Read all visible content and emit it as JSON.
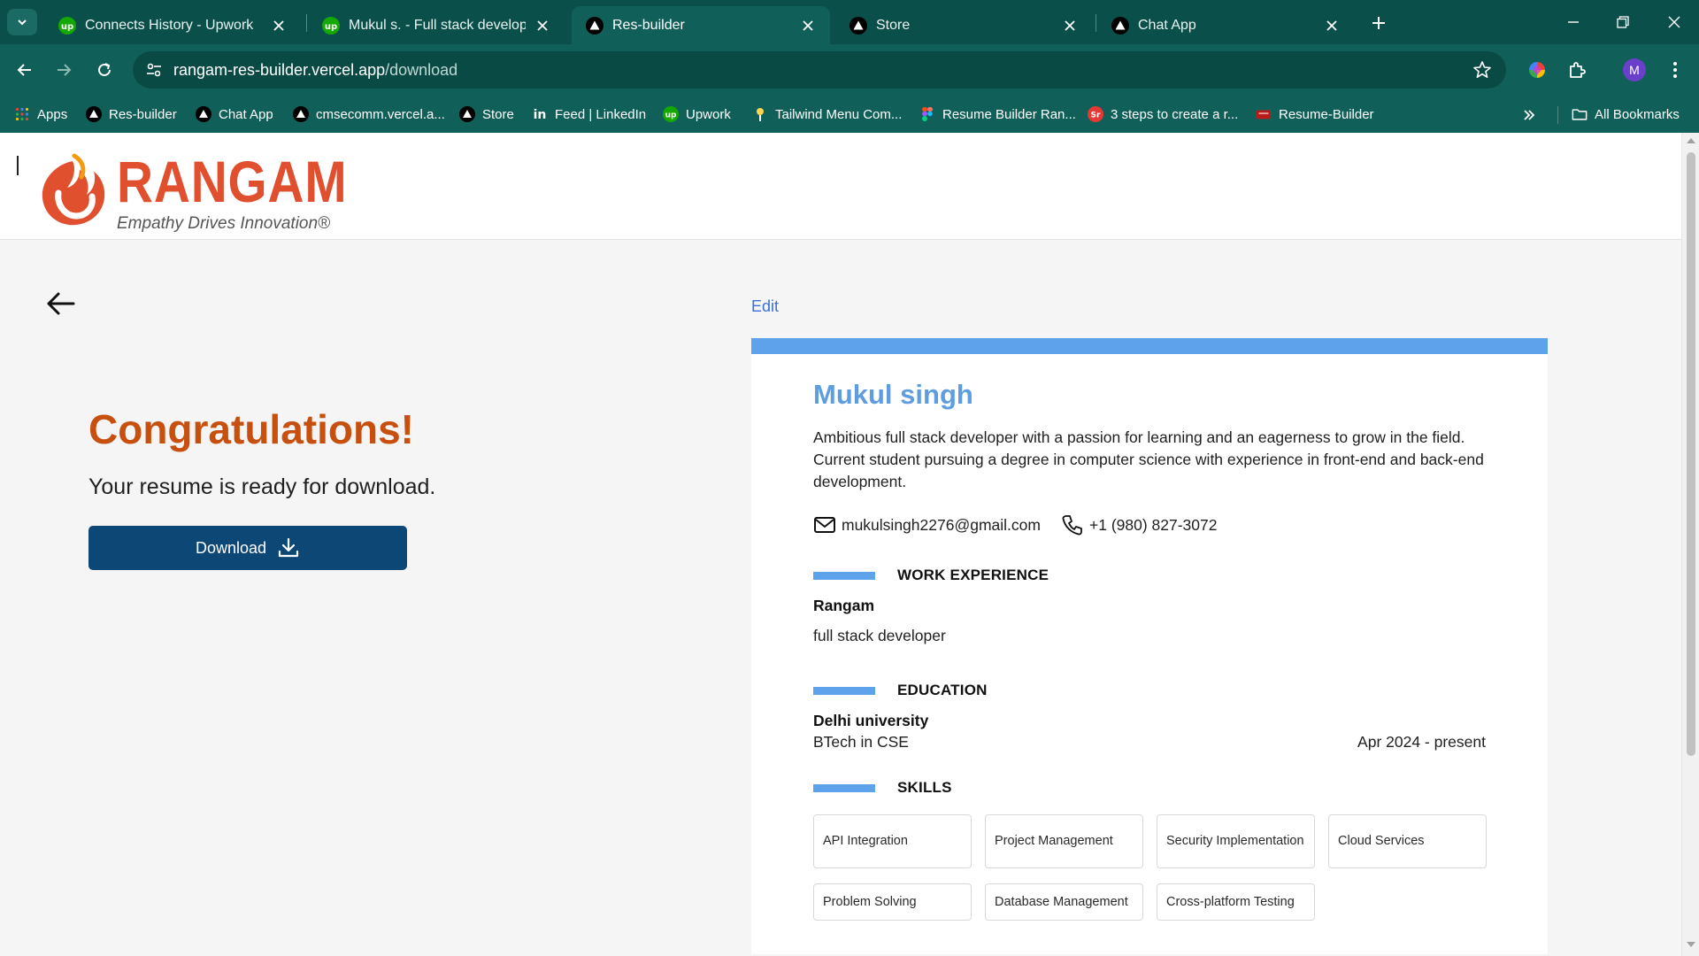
{
  "browser": {
    "tabs": [
      {
        "title": "Connects History - Upwork",
        "icon": "upwork-icon",
        "active": false
      },
      {
        "title": "Mukul s. - Full stack developer",
        "icon": "upwork-icon",
        "active": false
      },
      {
        "title": "Res-builder",
        "icon": "vercel-icon",
        "active": true
      },
      {
        "title": "Store",
        "icon": "vercel-icon",
        "active": false
      },
      {
        "title": "Chat App",
        "icon": "vercel-icon",
        "active": false
      }
    ],
    "address": {
      "domain": "rangam-res-builder.vercel.app",
      "path": "/download"
    },
    "profile_initial": "M",
    "bookmarks": [
      {
        "label": "Apps",
        "icon": "apps-grid-icon"
      },
      {
        "label": "Res-builder",
        "icon": "vercel-icon"
      },
      {
        "label": "Chat App",
        "icon": "vercel-icon"
      },
      {
        "label": "cmsecomm.vercel.a...",
        "icon": "vercel-icon"
      },
      {
        "label": "Store",
        "icon": "vercel-icon"
      },
      {
        "label": "Feed | LinkedIn",
        "icon": "linkedin-icon"
      },
      {
        "label": "Upwork",
        "icon": "upwork-icon"
      },
      {
        "label": "Tailwind Menu Com...",
        "icon": "map-pin-icon"
      },
      {
        "label": "Resume Builder Ran...",
        "icon": "figma-icon"
      },
      {
        "label": "3 steps to create a r...",
        "icon": "sr-icon"
      },
      {
        "label": "Resume-Builder",
        "icon": "resume-builder-icon"
      }
    ],
    "all_bookmarks": "All Bookmarks",
    "colors": {
      "chrome_dark": "#0b4f4a",
      "chrome": "#105f58"
    }
  },
  "site": {
    "logo_text": "RANGAM",
    "logo_tagline": "Empathy Drives Innovation®"
  },
  "main": {
    "congrats": "Congratulations!",
    "ready": "Your resume is ready for download.",
    "download_label": "Download",
    "edit_label": "Edit"
  },
  "resume": {
    "name": "Mukul singh",
    "summary": "Ambitious full stack developer with a passion for learning and an eagerness to grow in the field. Current student pursuing a degree in computer science with experience in front-end and back-end development.",
    "email": "mukulsingh2276@gmail.com",
    "phone": "+1 (980) 827-3072",
    "sections": {
      "work": "WORK EXPERIENCE",
      "education": "EDUCATION",
      "skills": "SKILLS"
    },
    "work": {
      "company": "Rangam",
      "role": "full stack developer"
    },
    "education": {
      "school": "Delhi university",
      "degree": "BTech in CSE",
      "dates": "Apr 2024 - present"
    },
    "skills": [
      "API Integration",
      "Project Management",
      "Security Implementation",
      "Cloud Services",
      "Problem Solving",
      "Database Management",
      "Cross-platform Testing"
    ],
    "colors": {
      "accent": "#5ea2ec",
      "name": "#5e9de0",
      "congrats": "#c8500f",
      "button": "#0c4776"
    }
  }
}
